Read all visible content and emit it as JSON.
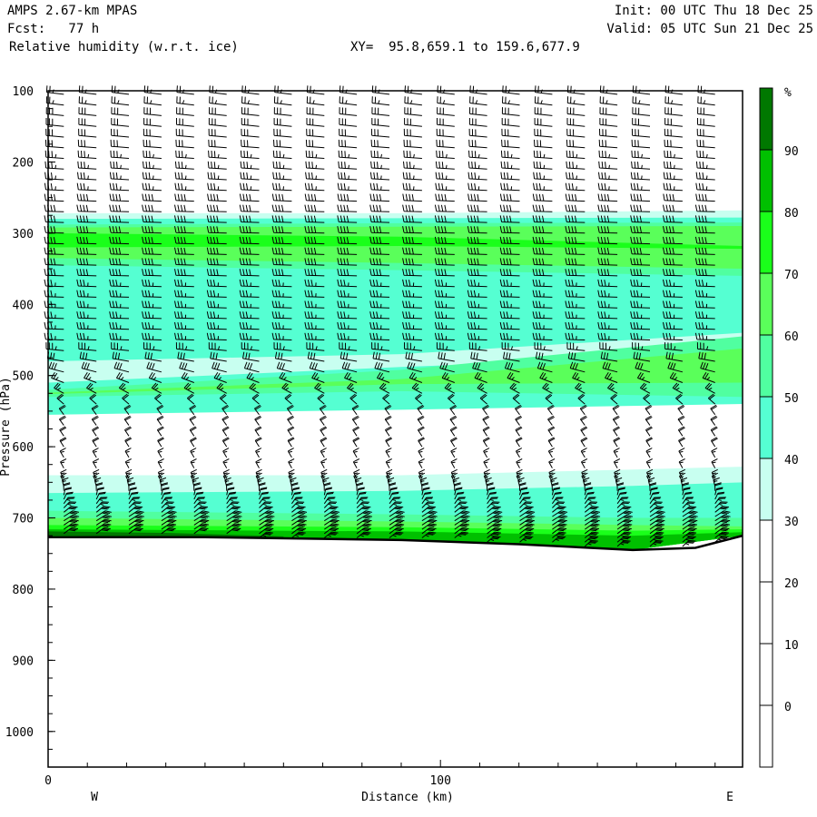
{
  "header": {
    "model": "AMPS 2.67-km MPAS",
    "fcst": "Fcst:   77 h",
    "field": "Relative humidity (w.r.t. ice)",
    "xy": "XY=  95.8,659.1 to 159.6,677.9",
    "init": "Init: 00 UTC Thu 18 Dec 25",
    "valid": "Valid: 05 UTC Sun 21 Dec 25"
  },
  "chart_data": {
    "type": "heatmap",
    "title": "Relative humidity (w.r.t. ice)",
    "xlabel": "Distance (km)",
    "ylabel": "Pressure (hPa)",
    "xlim": [
      0,
      177
    ],
    "ylim": [
      1050,
      100
    ],
    "x_ticks": [
      "0",
      "100"
    ],
    "x_tick_values": [
      0,
      100
    ],
    "y_ticks": [
      "100",
      "200",
      "300",
      "400",
      "500",
      "600",
      "700",
      "800",
      "900",
      "1000"
    ],
    "y_tick_values": [
      100,
      200,
      300,
      400,
      500,
      600,
      700,
      800,
      900,
      1000
    ],
    "left_label": "W",
    "right_label": "E",
    "colorbar": {
      "unit": "%",
      "labels": [
        "90",
        "80",
        "70",
        "60",
        "50",
        "40",
        "30",
        "20",
        "10",
        "0"
      ],
      "colors": [
        {
          "range": [
            90,
            100
          ],
          "color": "#007800"
        },
        {
          "range": [
            80,
            90
          ],
          "color": "#00c000"
        },
        {
          "range": [
            70,
            80
          ],
          "color": "#1aff1a"
        },
        {
          "range": [
            60,
            70
          ],
          "color": "#5aff5a"
        },
        {
          "range": [
            50,
            60
          ],
          "color": "#50ffa0"
        },
        {
          "range": [
            40,
            50
          ],
          "color": "#55ffd2"
        },
        {
          "range": [
            30,
            40
          ],
          "color": "#c8fff0"
        },
        {
          "range": [
            20,
            30
          ],
          "color": "#ffffff"
        },
        {
          "range": [
            10,
            20
          ],
          "color": "#ffffff"
        },
        {
          "range": [
            0,
            10
          ],
          "color": "#ffffff"
        },
        {
          "range": [
            -10,
            0
          ],
          "color": "#ffffff"
        }
      ]
    },
    "rh_bands": [
      {
        "level": 30,
        "points": [
          [
            0,
            272,
            555
          ],
          [
            90,
            272,
            545
          ],
          [
            177,
            268,
            540
          ]
        ]
      },
      {
        "level": 30,
        "points": [
          [
            0,
            640,
            727
          ],
          [
            90,
            640,
            732
          ],
          [
            149,
            632,
            745
          ],
          [
            177,
            628,
            725
          ]
        ]
      },
      {
        "level": 40,
        "points": [
          [
            0,
            280,
            480
          ],
          [
            90,
            279,
            470
          ],
          [
            177,
            278,
            440
          ]
        ]
      },
      {
        "level": 40,
        "points": [
          [
            0,
            510,
            555
          ],
          [
            90,
            488,
            548
          ],
          [
            177,
            470,
            540
          ]
        ]
      },
      {
        "level": 40,
        "points": [
          [
            0,
            665,
            727
          ],
          [
            90,
            662,
            732
          ],
          [
            149,
            655,
            745
          ],
          [
            177,
            650,
            725
          ]
        ]
      },
      {
        "level": 50,
        "points": [
          [
            0,
            288,
            345
          ],
          [
            90,
            286,
            352
          ],
          [
            177,
            285,
            360
          ]
        ]
      },
      {
        "level": 50,
        "points": [
          [
            0,
            520,
            530
          ],
          [
            90,
            492,
            522
          ],
          [
            177,
            445,
            530
          ]
        ]
      },
      {
        "level": 50,
        "points": [
          [
            0,
            690,
            727
          ],
          [
            90,
            695,
            732
          ],
          [
            149,
            700,
            745
          ],
          [
            177,
            700,
            725
          ]
        ]
      },
      {
        "level": 60,
        "points": [
          [
            0,
            292,
            335
          ],
          [
            90,
            291,
            342
          ],
          [
            177,
            290,
            350
          ]
        ]
      },
      {
        "level": 60,
        "points": [
          [
            0,
            524,
            526
          ],
          [
            90,
            505,
            512
          ],
          [
            177,
            462,
            510
          ]
        ]
      },
      {
        "level": 60,
        "points": [
          [
            0,
            700,
            727
          ],
          [
            90,
            705,
            732
          ],
          [
            149,
            710,
            745
          ],
          [
            177,
            712,
            725
          ]
        ]
      },
      {
        "level": 70,
        "points": [
          [
            0,
            300,
            320
          ],
          [
            90,
            305,
            318
          ],
          [
            177,
            318,
            322
          ]
        ]
      },
      {
        "level": 70,
        "points": [
          [
            0,
            710,
            727
          ],
          [
            90,
            713,
            732
          ],
          [
            149,
            718,
            745
          ],
          [
            177,
            716,
            725
          ]
        ]
      },
      {
        "level": 80,
        "points": [
          [
            0,
            716,
            727
          ],
          [
            90,
            719,
            732
          ],
          [
            149,
            725,
            745
          ],
          [
            177,
            720,
            725
          ]
        ]
      },
      {
        "level": 90,
        "points": [
          [
            0,
            719,
            725
          ],
          [
            30,
            721,
            726
          ],
          [
            60,
            726,
            727
          ]
        ]
      }
    ],
    "surface_pressure": [
      [
        0,
        727
      ],
      [
        40,
        727
      ],
      [
        90,
        731
      ],
      [
        120,
        737
      ],
      [
        149,
        745
      ],
      [
        165,
        742
      ],
      [
        177,
        725
      ]
    ],
    "wind_profile": [
      {
        "p": 100,
        "dir": 290,
        "speed": 25
      },
      {
        "p": 270,
        "dir": 275,
        "speed": 40
      },
      {
        "p": 450,
        "dir": 275,
        "speed": 35
      },
      {
        "p": 550,
        "dir": 345,
        "speed": 20
      },
      {
        "p": 650,
        "dir": 350,
        "speed": 15
      },
      {
        "p": 700,
        "dir": 30,
        "speed": 30
      },
      {
        "p": 745,
        "dir": 20,
        "speed": 35
      }
    ]
  }
}
